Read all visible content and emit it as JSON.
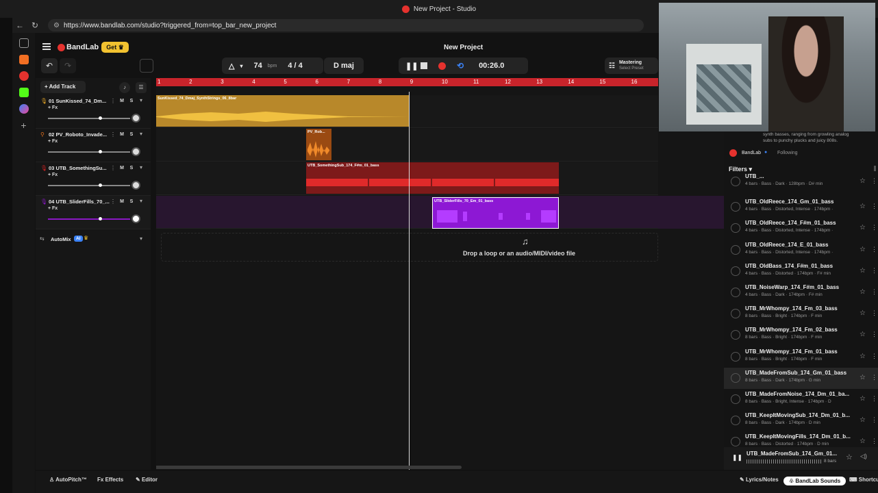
{
  "window": {
    "title": "New Project - Studio"
  },
  "browser": {
    "url": "https://www.bandlab.com/studio?triggered_from=top_bar_new_project"
  },
  "header": {
    "logo": "BandLab",
    "get_label": "Get",
    "project_title": "New Project",
    "mastering_label": "Mastering",
    "mastering_sub": "Select Preset"
  },
  "transport": {
    "bpm": "74",
    "bpm_unit": "bpm",
    "time_sig": "4 / 4",
    "key": "D maj",
    "time": "00:26.0"
  },
  "tracks_panel": {
    "add_track_label": "Add Track",
    "automix_label": "AutoMix",
    "automix_badge": "AI"
  },
  "tracks": [
    {
      "num": "01",
      "name": "SunKissed_74_Dm...",
      "mute": "M",
      "solo": "S",
      "fx": "+ Fx",
      "color": "#d9a62a"
    },
    {
      "num": "02",
      "name": "PV_Roboto_Invade...",
      "mute": "M",
      "solo": "S",
      "fx": "+ Fx",
      "color": "#e1701d"
    },
    {
      "num": "03",
      "name": "UTB_SomethingSu...",
      "mute": "M",
      "solo": "S",
      "fx": "+ Fx",
      "color": "#d42323"
    },
    {
      "num": "04",
      "name": "UTB_SliderFills_70_...",
      "mute": "M",
      "solo": "S",
      "fx": "+ Fx",
      "color": "#8a18c4"
    }
  ],
  "ruler": [
    "1",
    "2",
    "3",
    "4",
    "5",
    "6",
    "7",
    "8",
    "9",
    "10",
    "11",
    "12",
    "13",
    "14",
    "15",
    "16"
  ],
  "clips": {
    "c1": "SunKissed_74_Dmaj_SynthStrings_06_8bar",
    "c2": "PV_Rob...",
    "c3": "UTB_SomethingSub_174_F#m_01_bass",
    "c4": "UTB_SliderFills_70_Em_01_bass"
  },
  "drop_hint": "Drop a loop or an audio/MIDI/video file",
  "sounds": {
    "desc_line1": "synth basses, ranging from growling analog",
    "desc_line2": "subs to punchy plucks and juicy 808s.",
    "author": "BandLab",
    "following": "Following",
    "filters_label": "Filters",
    "items": [
      {
        "name": "UTB_...",
        "meta": "4 bars · Bass · Dark · 128bpm · D# min"
      },
      {
        "name": "UTB_OldReece_174_Gm_01_bass",
        "meta": "4 bars · Bass · Distorted, Intense · 174bpm ·"
      },
      {
        "name": "UTB_OldReece_174_F#m_01_bass",
        "meta": "4 bars · Bass · Distorted, Intense · 174bpm ·"
      },
      {
        "name": "UTB_OldReece_174_E_01_bass",
        "meta": "4 bars · Bass · Distorted, Intense · 174bpm ·"
      },
      {
        "name": "UTB_OldBass_174_F#m_01_bass",
        "meta": "4 bars · Bass · Distorted · 174bpm · F# min"
      },
      {
        "name": "UTB_NoiseWarp_174_F#m_01_bass",
        "meta": "4 bars · Bass · Dark · 174bpm · F# min"
      },
      {
        "name": "UTB_MrWhompy_174_Fm_03_bass",
        "meta": "8 bars · Bass · Bright · 174bpm · F min"
      },
      {
        "name": "UTB_MrWhompy_174_Fm_02_bass",
        "meta": "8 bars · Bass · Bright · 174bpm · F min"
      },
      {
        "name": "UTB_MrWhompy_174_Fm_01_bass",
        "meta": "8 bars · Bass · Bright · 174bpm · F min"
      },
      {
        "name": "UTB_MadeFromSub_174_Gm_01_bass",
        "meta": "8 bars · Bass · Dark · 174bpm · G min"
      },
      {
        "name": "UTB_MadeFromNoise_174_Dm_01_ba...",
        "meta": "8 bars · Bass · Bright, Intense · 174bpm · D"
      },
      {
        "name": "UTB_KeepItMovingSub_174_Dm_01_b...",
        "meta": "8 bars · Bass · Dark · 174bpm · D min"
      },
      {
        "name": "UTB_KeepItMovingFills_174_Dm_01_b...",
        "meta": "8 bars · Bass · Distorted · 174bpm · D min"
      }
    ],
    "player_name": "UTB_MadeFromSub_174_Gm_01...",
    "player_meta": "8 bars"
  },
  "bottom": {
    "autopitch": "AutoPitch™",
    "effects": "Effects",
    "editor": "Editor",
    "lyrics": "Lyrics/Notes",
    "sounds": "BandLab Sounds",
    "shortcuts": "Shortcut"
  }
}
